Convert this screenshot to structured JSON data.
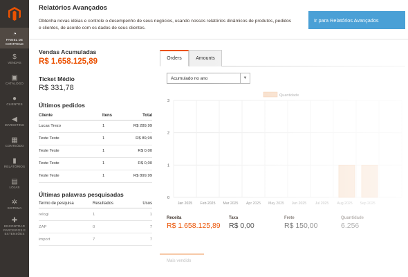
{
  "sidebar": {
    "items": [
      {
        "icon": "dashboard-icon",
        "glyph": "◔",
        "label": "PAINEL DE CONTROLE"
      },
      {
        "icon": "dollar-icon",
        "glyph": "$",
        "label": "VENDAS"
      },
      {
        "icon": "box-icon",
        "glyph": "▣",
        "label": "CATÁLOGO"
      },
      {
        "icon": "person-icon",
        "glyph": "●",
        "label": "CLIENTES"
      },
      {
        "icon": "megaphone-icon",
        "glyph": "◀",
        "label": "MARKETING"
      },
      {
        "icon": "content-icon",
        "glyph": "▦",
        "label": "CONTEÚDO"
      },
      {
        "icon": "bar-chart-icon",
        "glyph": "▮",
        "label": "RELATÓRIOS"
      },
      {
        "icon": "store-icon",
        "glyph": "▤",
        "label": "LOJAS"
      },
      {
        "icon": "gear-icon",
        "glyph": "✲",
        "label": "SISTEMA"
      },
      {
        "icon": "puzzle-icon",
        "glyph": "✚",
        "label": "ENCONTRAR PARCEIROS E EXTENSÕES"
      }
    ]
  },
  "advanced": {
    "title": "Relatórios Avançados",
    "description": "Obtenha novas idéias e controle o desempenho de seus negócios, usando nossos relatórios dinâmicos de produtos, pedidos e clientes, de acordo com os dados de seus clientes.",
    "button_label": "Ir para Relatórios Avançados"
  },
  "lifetime_sales": {
    "label": "Vendas Acumuladas",
    "value": "R$ 1.658.125,89"
  },
  "average_order": {
    "label": "Ticket Médio",
    "value": "R$ 331,78"
  },
  "last_orders": {
    "title": "Últimos pedidos",
    "headers": {
      "customer": "Cliente",
      "items": "Itens",
      "total": "Total"
    },
    "rows": [
      {
        "customer": "Lucas Trezo",
        "items": "1",
        "total": "R$ 289,99"
      },
      {
        "customer": "Teste Teste",
        "items": "1",
        "total": "R$ 89,99"
      },
      {
        "customer": "Teste Teste",
        "items": "1",
        "total": "R$ 0,00"
      },
      {
        "customer": "Teste Teste",
        "items": "1",
        "total": "R$ 0,00"
      },
      {
        "customer": "Teste Teste",
        "items": "1",
        "total": "R$ 899,99"
      }
    ]
  },
  "search_terms": {
    "title": "Últimas palavras pesquisadas",
    "headers": {
      "term": "Termo de pesquisa",
      "results": "Resultados",
      "uses": "Usos"
    },
    "rows": [
      {
        "term": "relogi",
        "results": "1",
        "uses": "1"
      },
      {
        "term": "ZAP",
        "results": "0",
        "uses": "7"
      },
      {
        "term": "import",
        "results": "7",
        "uses": "7"
      }
    ]
  },
  "dashboard": {
    "tabs": [
      "Orders",
      "Amounts"
    ],
    "period_select": "Acumulado no ano",
    "summary": [
      {
        "label": "Receita",
        "value": "R$ 1.658.125,89"
      },
      {
        "label": "Taxa",
        "value": "R$ 0,00"
      },
      {
        "label": "Frete",
        "value": "R$ 150,00"
      },
      {
        "label": "Quantidade",
        "value": "6.256"
      }
    ],
    "bottom_tabs": [
      "Mais vendido",
      ""
    ]
  },
  "colors": {
    "accent": "#eb5202",
    "sidebar": "#373330",
    "button": "#4aa0d6",
    "bar": "#f6d8bf"
  },
  "chart_data": {
    "type": "bar",
    "legend": [
      "Quantidade"
    ],
    "legend_position": "top",
    "categories": [
      "Jan 2025",
      "Feb 2025",
      "Mar 2025",
      "Apr 2025",
      "May 2025",
      "Jun 2025",
      "Jul 2025",
      "Aug 2025",
      "Sep 2025"
    ],
    "category_labels_shown": [
      "Jan 2025",
      "Feb 2025",
      "Mar 2025",
      "Apr 2025",
      "May 2025",
      "Jun 2025",
      "Jul 2025",
      "Aug 2025",
      "Sep 2025"
    ],
    "series": [
      {
        "name": "Quantidade",
        "values": [
          0,
          0,
          0,
          0,
          0,
          0,
          0,
          1,
          1
        ]
      }
    ],
    "y_ticks": [
      "0",
      "1",
      "2",
      "3"
    ],
    "ylim": [
      0,
      3
    ],
    "grid": true
  }
}
